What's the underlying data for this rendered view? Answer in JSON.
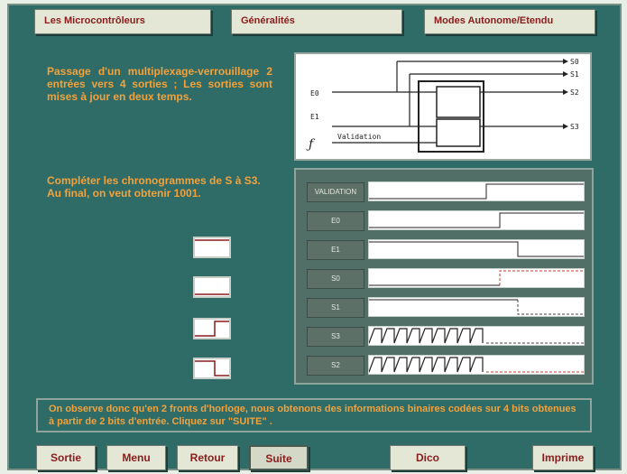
{
  "tabs": [
    {
      "label": "Les Microcontrôleurs"
    },
    {
      "label": "Généralités"
    },
    {
      "label": "Modes Autonome/Etendu"
    }
  ],
  "intro_text": "Passage d'un multiplexage-verrouillage 2 entrées vers 4 sorties ; Les sorties sont mises à jour en deux temps.",
  "task_text_1": "Compléter les chronogrammes de S à S3.",
  "task_text_2": "Au final, on veut obtenir 1001.",
  "schema": {
    "inputs": [
      "E0",
      "E1"
    ],
    "outputs": [
      "S0",
      "S1",
      "S2",
      "S3"
    ],
    "validation_label": "Validation",
    "validation_symbol": "ƒ"
  },
  "chrono": {
    "signals": [
      {
        "label": "VALIDATION"
      },
      {
        "label": "E0"
      },
      {
        "label": "E1"
      },
      {
        "label": "S0"
      },
      {
        "label": "S1"
      },
      {
        "label": "S3"
      },
      {
        "label": "S2"
      }
    ]
  },
  "message": "On observe donc qu'en 2 fronts d'horloge, nous obtenons des informations binaires codées sur 4 bits obtenues à partir de 2 bits d'entrée. Cliquez sur \"SUITE\" .",
  "buttons": {
    "sortie": "Sortie",
    "menu": "Menu",
    "retour": "Retour",
    "suite": "Suite",
    "dico": "Dico",
    "imprime": "Imprime"
  },
  "colors": {
    "background": "#2f6b67",
    "accent_text": "#f2a23c",
    "tab_text": "#8a1c1c"
  }
}
